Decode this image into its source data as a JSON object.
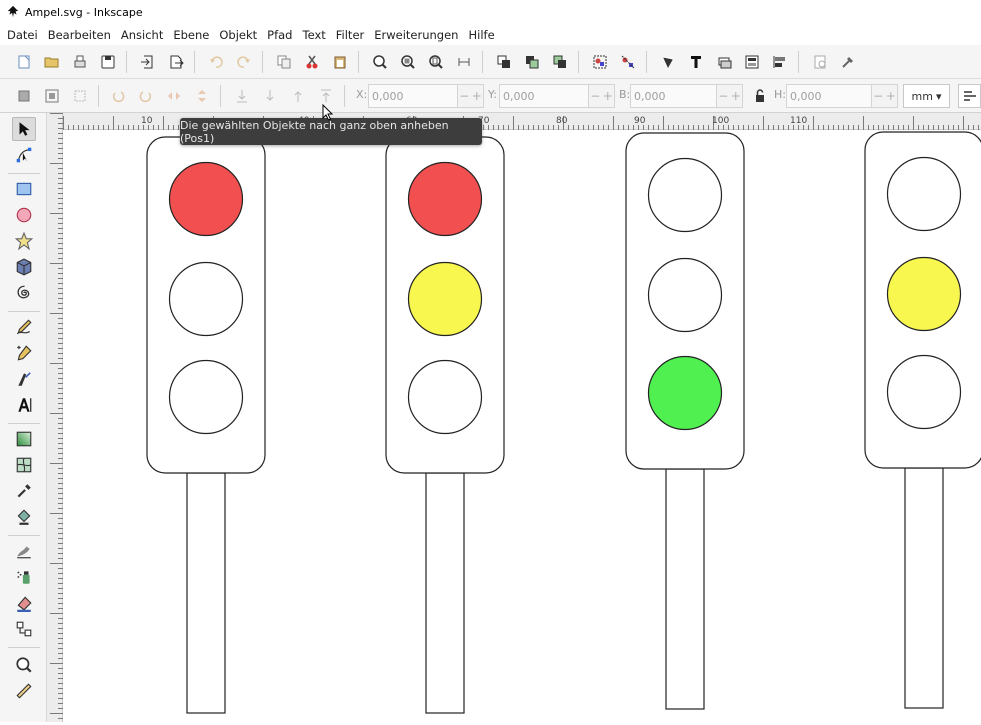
{
  "window": {
    "title": "Ampel.svg - Inkscape"
  },
  "menubar": [
    "Datei",
    "Bearbeiten",
    "Ansicht",
    "Ebene",
    "Objekt",
    "Pfad",
    "Text",
    "Filter",
    "Erweiterungen",
    "Hilfe"
  ],
  "controls": {
    "x_label": "X:",
    "x_value": "0,000",
    "y_label": "Y:",
    "y_value": "0,000",
    "w_label": "B:",
    "w_value": "0,000",
    "h_label": "H:",
    "h_value": "0,000",
    "unit": "mm"
  },
  "tooltip": {
    "text": "Die gewählten Objekte nach ganz oben anheben (Pos1)"
  },
  "ruler": {
    "h_labels": [
      "10",
      "40",
      "60",
      "70",
      "80",
      "90",
      "100",
      "110"
    ],
    "v_labels": []
  },
  "colors": {
    "red": "#f25050",
    "yellow": "#f7f750",
    "green": "#50f050",
    "off": "#ffffff"
  },
  "traffic_lights": [
    {
      "name": "ampel-1",
      "top": "red",
      "middle": "off",
      "bottom": "off"
    },
    {
      "name": "ampel-2",
      "top": "red",
      "middle": "yellow",
      "bottom": "off"
    },
    {
      "name": "ampel-3",
      "top": "off",
      "middle": "off",
      "bottom": "green"
    },
    {
      "name": "ampel-4",
      "top": "off",
      "middle": "yellow",
      "bottom": "off"
    }
  ]
}
